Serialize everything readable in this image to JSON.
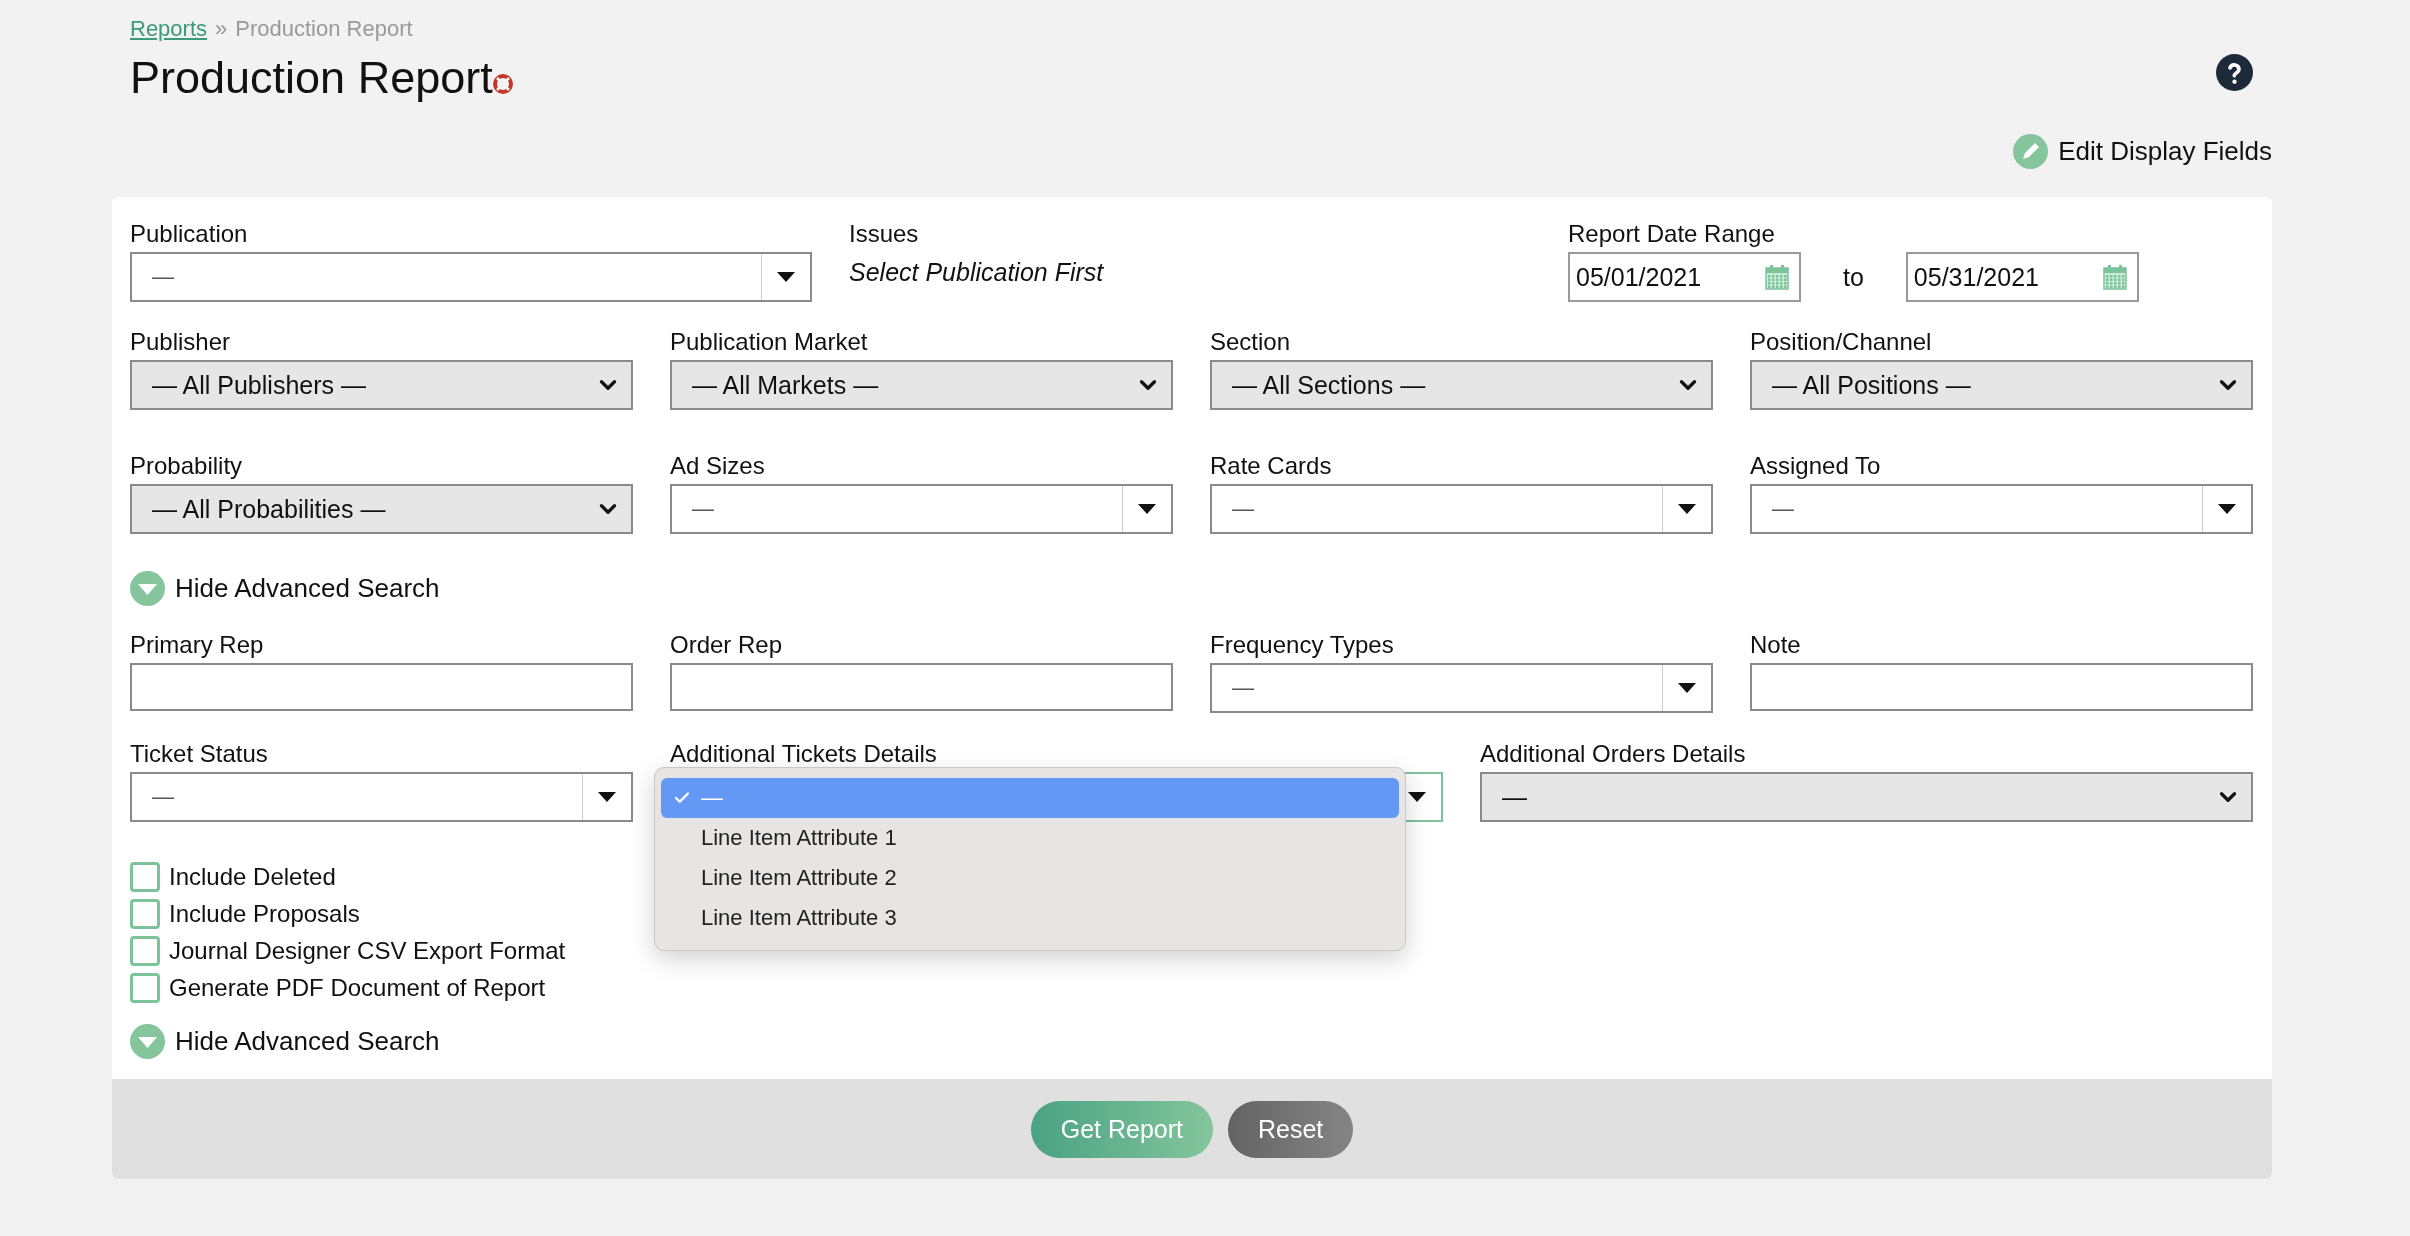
{
  "breadcrumb": {
    "separator": "»",
    "items": [
      {
        "label": "Reports",
        "kind": "link"
      },
      {
        "label": "Production Report",
        "kind": "current"
      }
    ]
  },
  "page": {
    "title": "Production Report"
  },
  "edit_display_fields": "Edit Display Fields",
  "rows": [
    {
      "kind": "top",
      "fields": [
        {
          "label": "Publication",
          "kind": "combo",
          "value": "—"
        },
        {
          "label": "Issues",
          "kind": "note",
          "value": "Select Publication First"
        },
        {
          "label": "Report Date Range",
          "kind": "daterange",
          "from": "05/01/2021",
          "joiner": "to",
          "to": "05/31/2021"
        }
      ]
    },
    {
      "kind": "quad",
      "fields": [
        {
          "label": "Publisher",
          "kind": "select",
          "value": "— All Publishers —"
        },
        {
          "label": "Publication Market",
          "kind": "select",
          "value": "— All Markets —"
        },
        {
          "label": "Section",
          "kind": "select",
          "value": "— All Sections —"
        },
        {
          "label": "Position/Channel",
          "kind": "select",
          "value": "— All Positions —"
        }
      ]
    },
    {
      "kind": "quad",
      "fields": [
        {
          "label": "Probability",
          "kind": "select",
          "value": "— All Probabilities —"
        },
        {
          "label": "Ad Sizes",
          "kind": "combo",
          "value": "—"
        },
        {
          "label": "Rate Cards",
          "kind": "combo",
          "value": "—"
        },
        {
          "label": "Assigned To",
          "kind": "combo",
          "value": "—"
        }
      ]
    },
    {
      "kind": "toggle",
      "label": "Hide Advanced Search"
    },
    {
      "kind": "quad",
      "fields": [
        {
          "label": "Primary Rep",
          "kind": "text"
        },
        {
          "label": "Order Rep",
          "kind": "text"
        },
        {
          "label": "Frequency Types",
          "kind": "combo",
          "value": "—"
        },
        {
          "label": "Note",
          "kind": "text"
        }
      ]
    },
    {
      "kind": "wide",
      "fields": [
        {
          "label": "Ticket Status",
          "kind": "combo",
          "value": "—"
        },
        {
          "label": "Additional Tickets Details",
          "kind": "combo",
          "open": true,
          "options": [
            {
              "label": "—",
              "selected": true
            },
            {
              "label": "Line Item Attribute 1",
              "selected": false
            },
            {
              "label": "Line Item Attribute 2",
              "selected": false
            },
            {
              "label": "Line Item Attribute 3",
              "selected": false
            }
          ]
        },
        {
          "label": "Additional Orders Details",
          "kind": "select",
          "value": "—"
        }
      ]
    },
    {
      "kind": "checks",
      "items": [
        {
          "label": "Include Deleted",
          "checked": false
        },
        {
          "label": "Include Proposals",
          "checked": false
        },
        {
          "label": "Journal Designer CSV Export Format",
          "checked": false
        },
        {
          "label": "Generate PDF Document of Report",
          "checked": false
        }
      ]
    },
    {
      "kind": "toggle",
      "label": "Hide Advanced Search"
    }
  ],
  "buttons": [
    {
      "label": "Get Report",
      "kind": "primary"
    },
    {
      "label": "Reset",
      "kind": "secondary"
    }
  ]
}
